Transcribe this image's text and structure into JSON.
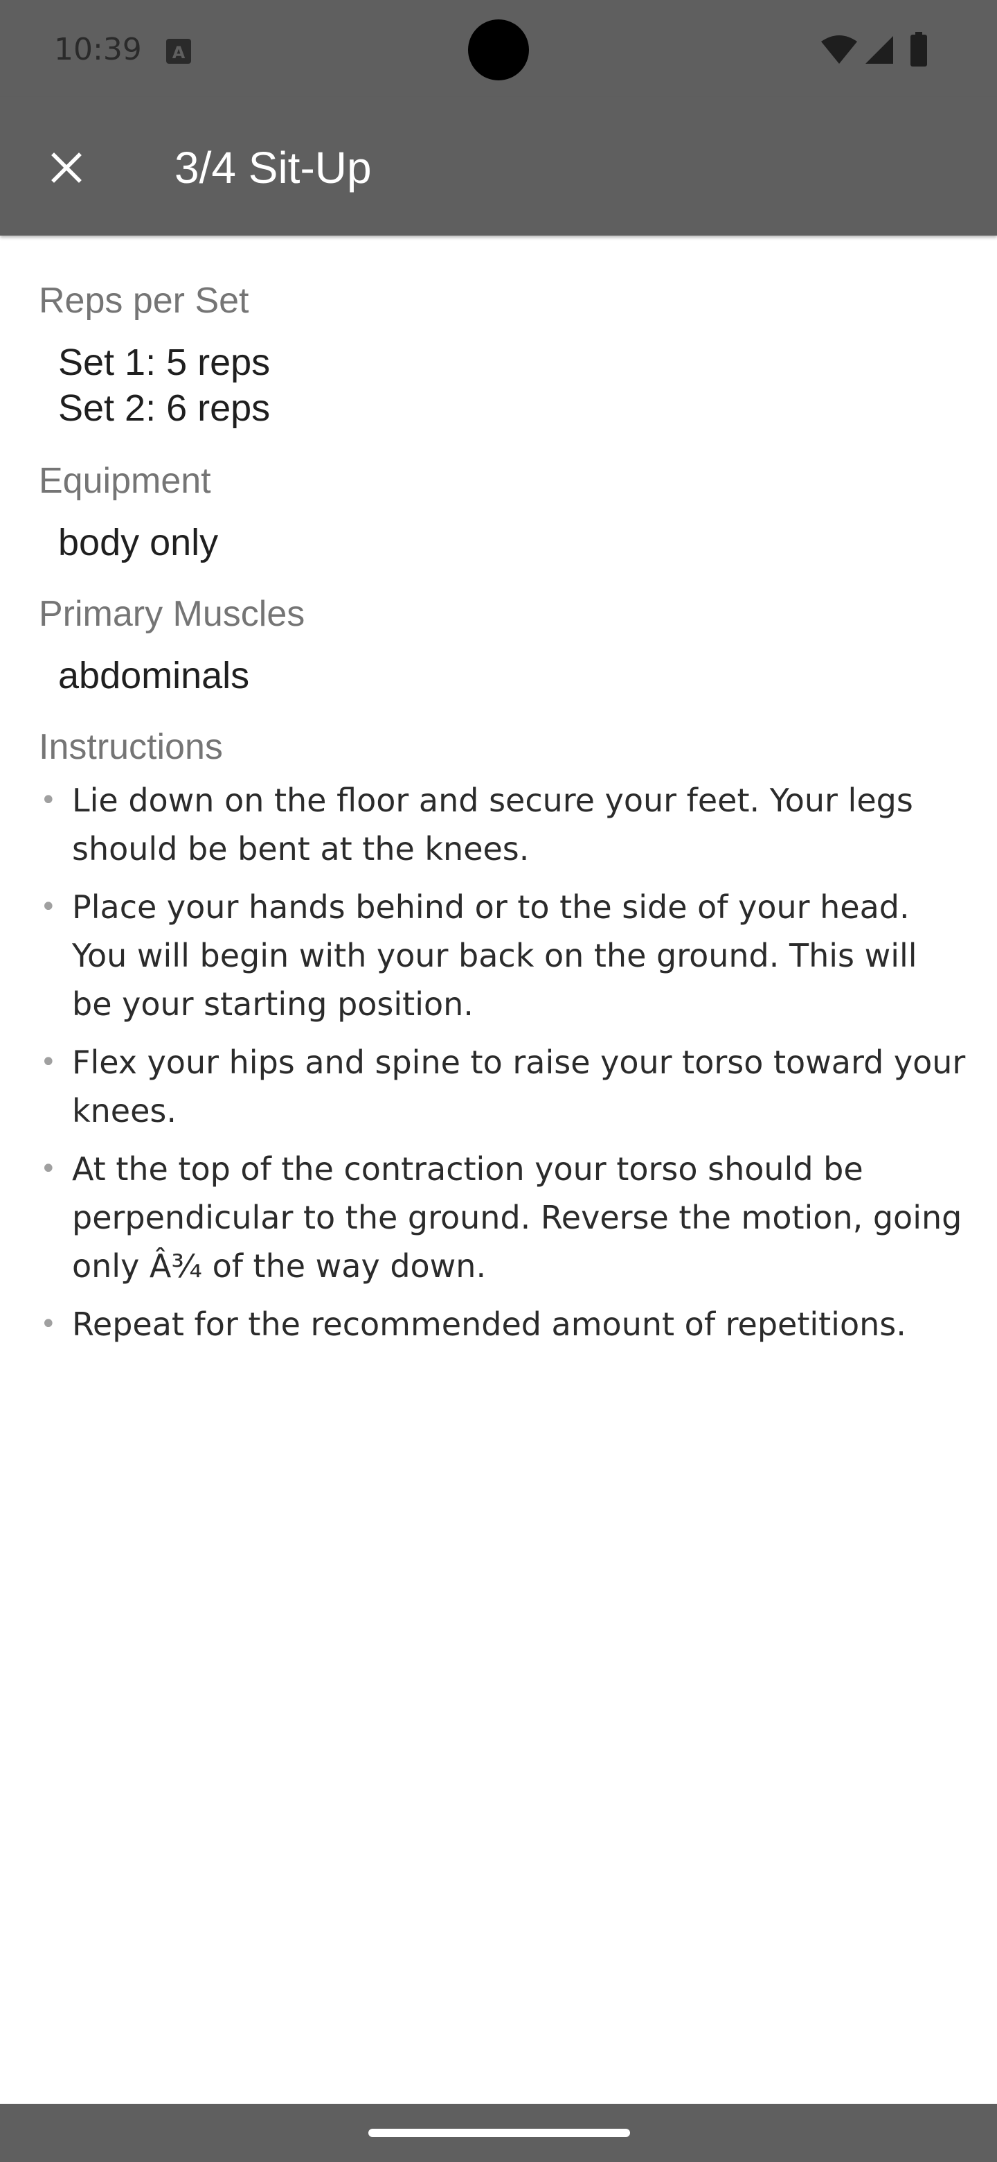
{
  "status_bar": {
    "time": "10:39",
    "icons": [
      "a-notification-icon",
      "wifi-icon",
      "signal-icon",
      "battery-icon"
    ]
  },
  "app_bar": {
    "title": "3/4 Sit-Up",
    "close_icon": "close-icon",
    "background": "#5f5f5f"
  },
  "sections": {
    "reps": {
      "label": "Reps per Set",
      "set1": "Set 1: 5 reps",
      "set2": "Set 2: 6 reps"
    },
    "equipment": {
      "label": "Equipment",
      "value": "body only"
    },
    "primary_muscles": {
      "label": "Primary Muscles",
      "value": "abdominals"
    },
    "instructions": {
      "label": "Instructions",
      "items": [
        "Lie down on the floor and secure your feet. Your legs should be bent at the knees.",
        "Place your hands behind or to the side of your head. You will begin with your back on the ground. This will be your starting position.",
        "Flex your hips and spine to raise your torso toward your knees.",
        "At the top of the contraction your torso should be perpendicular to the ground. Reverse the motion, going only Â¾ of the way down.",
        "Repeat for the recommended amount of repetitions."
      ]
    }
  }
}
